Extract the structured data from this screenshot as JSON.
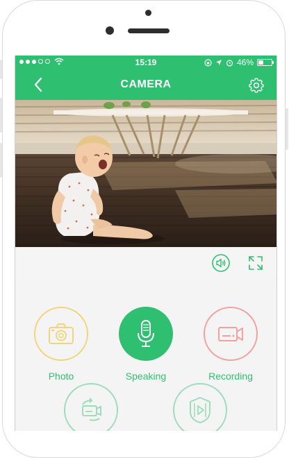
{
  "status_bar": {
    "time": "15:19",
    "battery_text": "46%",
    "battery_level": 0.46
  },
  "nav": {
    "title": "CAMERA"
  },
  "actions": [
    {
      "label": "Photo",
      "color": "#f2d57a",
      "icon": "camera-icon"
    },
    {
      "label": "Speaking",
      "color": "#2fbf71",
      "icon": "microphone-icon"
    },
    {
      "label": "Recording",
      "color": "#f2a0a0",
      "icon": "video-camera-icon"
    },
    {
      "label": "",
      "color": "#9edcbc",
      "icon": "video-rotate-icon"
    },
    {
      "label": "",
      "color": "#9edcbc",
      "icon": "video-play-icon"
    }
  ],
  "colors": {
    "brand_green": "#2fbf71",
    "photo_yellow": "#f2d57a",
    "recording_red": "#f2a0a0"
  }
}
